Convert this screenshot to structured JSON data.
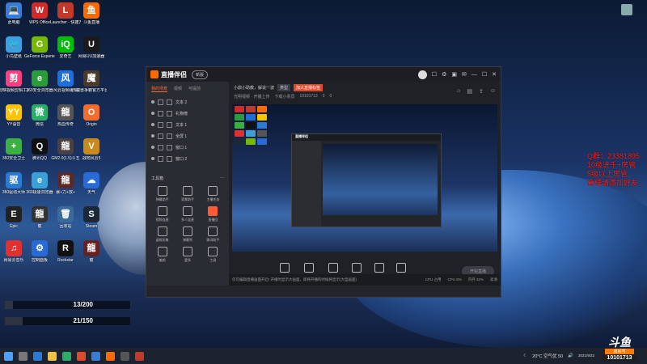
{
  "desktop": {
    "icons": [
      {
        "label": "此电脑",
        "glyph": "💻",
        "color": "#3a7bd5"
      },
      {
        "label": "WPS Office",
        "glyph": "W",
        "color": "#d02a2a"
      },
      {
        "label": "Launcher - 快捷方式",
        "glyph": "L",
        "color": "#c0392b"
      },
      {
        "label": "斗鱼直播",
        "glyph": "鱼",
        "color": "#ff6a00"
      },
      {
        "label": "小鸟壁纸",
        "glyph": "🐦",
        "color": "#3aa0e0"
      },
      {
        "label": "GeForce Experience",
        "glyph": "G",
        "color": "#76b900"
      },
      {
        "label": "爱奇艺",
        "glyph": "iQ",
        "color": "#00be06"
      },
      {
        "label": "网易UU加速器",
        "glyph": "U",
        "color": "#1a1a1a"
      },
      {
        "label": "剪映视频剪辑工具",
        "glyph": "剪",
        "color": "#ff3e7f"
      },
      {
        "label": "360安全浏览器",
        "glyph": "e",
        "color": "#2a9d3a"
      },
      {
        "label": "风云视频编辑",
        "glyph": "风",
        "color": "#1e6fd9"
      },
      {
        "label": "魔兽争霸官方平台",
        "glyph": "魔",
        "color": "#4a3a2a"
      },
      {
        "label": "YY语音",
        "glyph": "YY",
        "color": "#ffc400"
      },
      {
        "label": "微信",
        "glyph": "微",
        "color": "#2aae67"
      },
      {
        "label": "热血传奇",
        "glyph": "龍",
        "color": "#555"
      },
      {
        "label": "Origin",
        "glyph": "O",
        "color": "#f56c2d"
      },
      {
        "label": "360安全卫士",
        "glyph": "+",
        "color": "#3cb043"
      },
      {
        "label": "腾讯QQ",
        "glyph": "Q",
        "color": "#111"
      },
      {
        "label": "GM2.0(1.5)斗五",
        "glyph": "龍",
        "color": "#4a4040"
      },
      {
        "label": "战地风云5",
        "glyph": "V",
        "color": "#c88a1a"
      },
      {
        "label": "360驱动大师",
        "glyph": "驱",
        "color": "#2a7ad5"
      },
      {
        "label": "360极速浏览器",
        "glyph": "e",
        "color": "#3aa0d5"
      },
      {
        "label": "暴+力+放+",
        "glyph": "龍",
        "color": "#5a2a2a"
      },
      {
        "label": "天气",
        "glyph": "☁",
        "color": "#2a6ad5"
      },
      {
        "label": "Epic",
        "glyph": "E",
        "color": "#222"
      },
      {
        "label": "龍",
        "glyph": "龍",
        "color": "#333"
      },
      {
        "label": "回收站",
        "glyph": "🗑",
        "color": "#3a6a9a"
      },
      {
        "label": "Steam",
        "glyph": "S",
        "color": "#1b2838"
      },
      {
        "label": "网易云音乐",
        "glyph": "♫",
        "color": "#e03030"
      },
      {
        "label": "控制面板",
        "glyph": "⚙",
        "color": "#2a6ad5"
      },
      {
        "label": "Rockstar",
        "glyph": "R",
        "color": "#111"
      },
      {
        "label": "龍",
        "glyph": "龍",
        "color": "#662222"
      }
    ],
    "system_icon_label": "Recycle",
    "progress_bars": [
      {
        "text": "13/200",
        "fraction": 0.065
      },
      {
        "text": "21/150",
        "fraction": 0.14
      }
    ],
    "progress_labels": [
      "Microsoft Edge",
      "斗鱼直播伴侣"
    ],
    "red_overlay": [
      "Q群：23381895",
      "10级进千+房管",
      "5级以上房管",
      "管理请添加好友"
    ]
  },
  "app": {
    "title": "直播伴侣",
    "badge": "新版",
    "titlebar_icons": [
      "头像",
      "☐",
      "⚙",
      "▣",
      "✉",
      "—",
      "☐",
      "✕"
    ],
    "left_tabs": [
      "我的场景",
      "视频",
      "可提前"
    ],
    "sources": [
      "文本 2",
      "礼物榜",
      "文本 1",
      "全屏 1",
      "窗口 1",
      "窗口 2"
    ],
    "tools_header": "工具箱",
    "tools": [
      {
        "label": "弹幕助手",
        "red": false
      },
      {
        "label": "背景助手",
        "red": false
      },
      {
        "label": "主播任务",
        "red": false
      },
      {
        "label": "视频连麦",
        "red": false
      },
      {
        "label": "多人连麦",
        "red": false
      },
      {
        "label": "直播回",
        "red": true
      },
      {
        "label": "虚拟形象",
        "red": false
      },
      {
        "label": "弹幕秀",
        "red": false
      },
      {
        "label": "歌词助手",
        "red": false
      },
      {
        "label": "美颜",
        "red": false
      },
      {
        "label": "更多",
        "red": false
      },
      {
        "label": "工具",
        "red": false
      }
    ],
    "header": {
      "stream_title": "小鼎小助教，解说一波",
      "tag1": "类型",
      "tag2": "加大直播标签",
      "sub1": "光明视频 · 开播上传",
      "sub2": "下载小票员",
      "room": "10101713",
      "count1": "0",
      "count2": "0"
    },
    "bottom_buttons": [
      "直播屏幕",
      "摄像头",
      "手机投屏",
      "多媒体",
      "麦克风",
      "扬声器"
    ],
    "start_button": "开始直播",
    "status_left": "仅可编辑直播画面开启! 开播时显示大画面，即将开播的时候将显示(大型画面)",
    "status_right": [
      "CPU 占用",
      "CPU 8%",
      "内存 32%",
      "高清"
    ]
  },
  "taskbar": {
    "weather": "20°C 空气优 50",
    "time": "",
    "date": "2021/9/22"
  },
  "douyu": {
    "brand": "斗鱼",
    "room_label": "房间号",
    "room_number": "10101713"
  }
}
